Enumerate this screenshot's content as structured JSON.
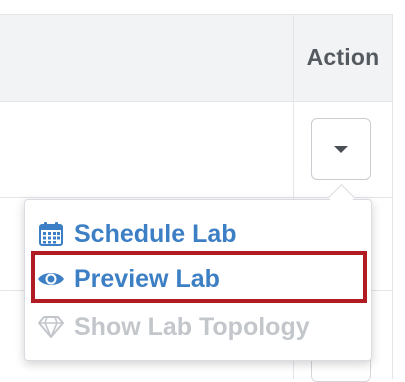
{
  "table": {
    "action_header": "Action"
  },
  "dropdown": {
    "toggle_icon": "caret-down-icon",
    "items": [
      {
        "label": "Schedule Lab",
        "icon": "calendar-icon",
        "enabled": true,
        "color": "#3d7fc4"
      },
      {
        "label": "Preview Lab",
        "icon": "eye-icon",
        "enabled": true,
        "color": "#3d7fc4",
        "highlighted": true
      },
      {
        "label": "Show Lab Topology",
        "icon": "diamond-icon",
        "enabled": false,
        "color": "#c3c7cc"
      }
    ]
  },
  "colors": {
    "link": "#3d7fc4",
    "disabled": "#c3c7cc",
    "highlight_border": "#b01c22",
    "header_bg": "#f2f3f5"
  }
}
